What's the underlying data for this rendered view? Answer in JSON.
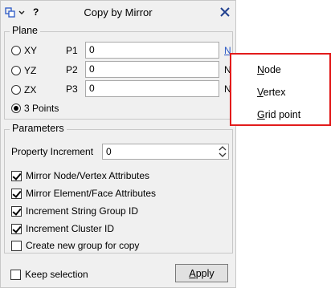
{
  "dialog": {
    "title": "Copy by Mirror",
    "help_label": "?"
  },
  "plane": {
    "group_label": "Plane",
    "options": [
      {
        "label": "XY",
        "selected": false
      },
      {
        "label": "YZ",
        "selected": false
      },
      {
        "label": "ZX",
        "selected": false
      },
      {
        "label": "3 Points",
        "selected": true
      }
    ],
    "points": [
      {
        "label": "P1",
        "value": "0",
        "button": "N"
      },
      {
        "label": "P2",
        "value": "0",
        "button": "N"
      },
      {
        "label": "P3",
        "value": "0",
        "button": "N"
      }
    ]
  },
  "parameters": {
    "group_label": "Parameters",
    "property_increment_label": "Property Increment",
    "property_increment_value": "0",
    "checkboxes": [
      {
        "label": "Mirror Node/Vertex Attributes",
        "checked": true
      },
      {
        "label": "Mirror Element/Face Attributes",
        "checked": true
      },
      {
        "label": "Increment String Group ID",
        "checked": true
      },
      {
        "label": "Increment Cluster ID",
        "checked": true
      },
      {
        "label": "Create new group for copy",
        "checked": false
      }
    ]
  },
  "footer": {
    "keep_selection_label": "Keep selection",
    "keep_selection_checked": false,
    "apply_label": "Apply"
  },
  "popup_menu": {
    "items": [
      "Node",
      "Vertex",
      "Grid point"
    ],
    "border_color": "#e21b1b"
  },
  "icons": {
    "menu": "panel-menu-icon",
    "close": "close-icon",
    "spin": "spinner-arrows-icon"
  }
}
